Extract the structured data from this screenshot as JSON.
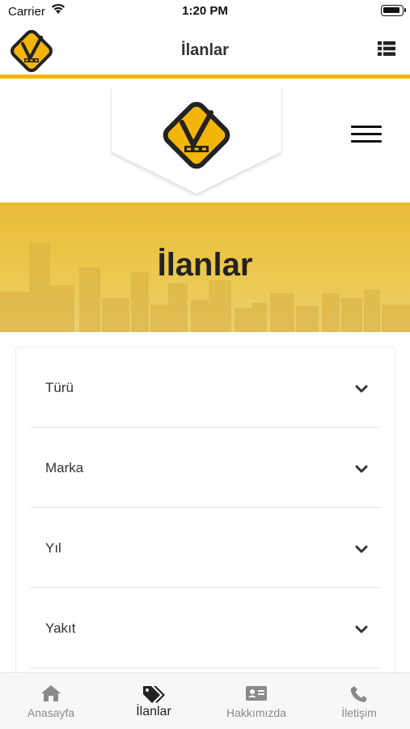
{
  "status_bar": {
    "carrier": "Carrier",
    "time": "1:20 PM"
  },
  "header": {
    "title": "İlanlar"
  },
  "banner": {
    "title": "İlanlar"
  },
  "filters": [
    {
      "label": "Türü"
    },
    {
      "label": "Marka"
    },
    {
      "label": "Yıl"
    },
    {
      "label": "Yakıt"
    }
  ],
  "tabs": [
    {
      "label": "Anasayfa",
      "icon": "home-icon",
      "active": false
    },
    {
      "label": "İlanlar",
      "icon": "tags-icon",
      "active": true
    },
    {
      "label": "Hakkımızda",
      "icon": "id-card-icon",
      "active": false
    },
    {
      "label": "İletişim",
      "icon": "phone-icon",
      "active": false
    }
  ],
  "colors": {
    "accent": "#f2b60a",
    "banner": "#ecc84e",
    "logo_dark": "#222222"
  }
}
